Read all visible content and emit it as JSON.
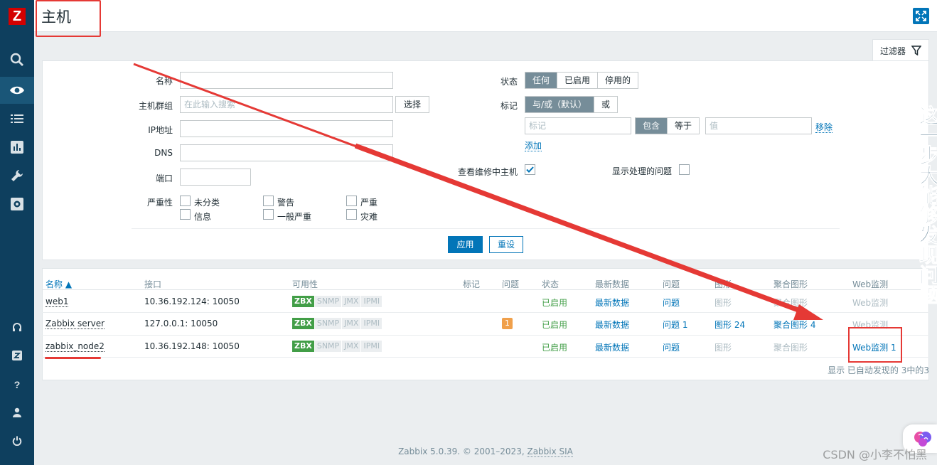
{
  "app": {
    "logo": "Z"
  },
  "header": {
    "title": "主机"
  },
  "filter": {
    "tab_label": "过滤器",
    "name_label": "名称",
    "group_label": "主机群组",
    "group_placeholder": "在此输入搜索",
    "group_select": "选择",
    "ip_label": "IP地址",
    "dns_label": "DNS",
    "port_label": "端口",
    "severity_label": "严重性",
    "severities": [
      "未分类",
      "警告",
      "严重",
      "信息",
      "一般严重",
      "灾难"
    ],
    "status_label": "状态",
    "status_options": [
      "任何",
      "已启用",
      "停用的"
    ],
    "status_selected": "任何",
    "tags_label": "标记",
    "tags_mode": [
      "与/或（默认）",
      "或"
    ],
    "tag_placeholder": "标记",
    "tag_ops": [
      "包含",
      "等于"
    ],
    "value_placeholder": "值",
    "remove": "移除",
    "add": "添加",
    "maintenance_label": "查看维修中主机",
    "maintenance_checked": true,
    "suppressed_label": "显示处理的问题",
    "suppressed_checked": false,
    "apply": "应用",
    "reset": "重设"
  },
  "table": {
    "headers": [
      "名称 ▲",
      "接口",
      "可用性",
      "标记",
      "问题",
      "状态",
      "最新数据",
      "问题",
      "图形",
      "聚合图形",
      "Web监测"
    ],
    "availability_labels": [
      "ZBX",
      "SNMP",
      "JMX",
      "IPMI"
    ],
    "rows": [
      {
        "name": "web1",
        "interface": "10.36.192.124: 10050",
        "problems": "",
        "status": "已启用",
        "latest": "最新数据",
        "problems_link": "问题",
        "graphs": "图形",
        "screens": "聚合图形",
        "web": "Web监测"
      },
      {
        "name": "Zabbix server",
        "interface": "127.0.0.1: 10050",
        "problems": "1",
        "status": "已启用",
        "latest": "最新数据",
        "problems_link": "问题 1",
        "graphs": "图形 24",
        "screens": "聚合图形 4",
        "web": "Web监测"
      },
      {
        "name": "zabbix_node2",
        "interface": "10.36.192.148: 10050",
        "problems": "",
        "status": "已启用",
        "latest": "最新数据",
        "problems_link": "问题",
        "graphs": "图形",
        "screens": "聚合图形",
        "web": "Web监测 1"
      }
    ],
    "summary": "显示 已自动发现的 3中的3"
  },
  "footer": {
    "text": "Zabbix 5.0.39. © 2001–2023, ",
    "link": "Zabbix SIA"
  },
  "watermark": "CSDN @小李不怕黑",
  "side_annotation": "这一步大能够发现问题",
  "colors": {
    "sidebar": "#0e3f5e",
    "accent": "#0275b8",
    "ok": "#429e47",
    "annotation": "#e53935"
  }
}
